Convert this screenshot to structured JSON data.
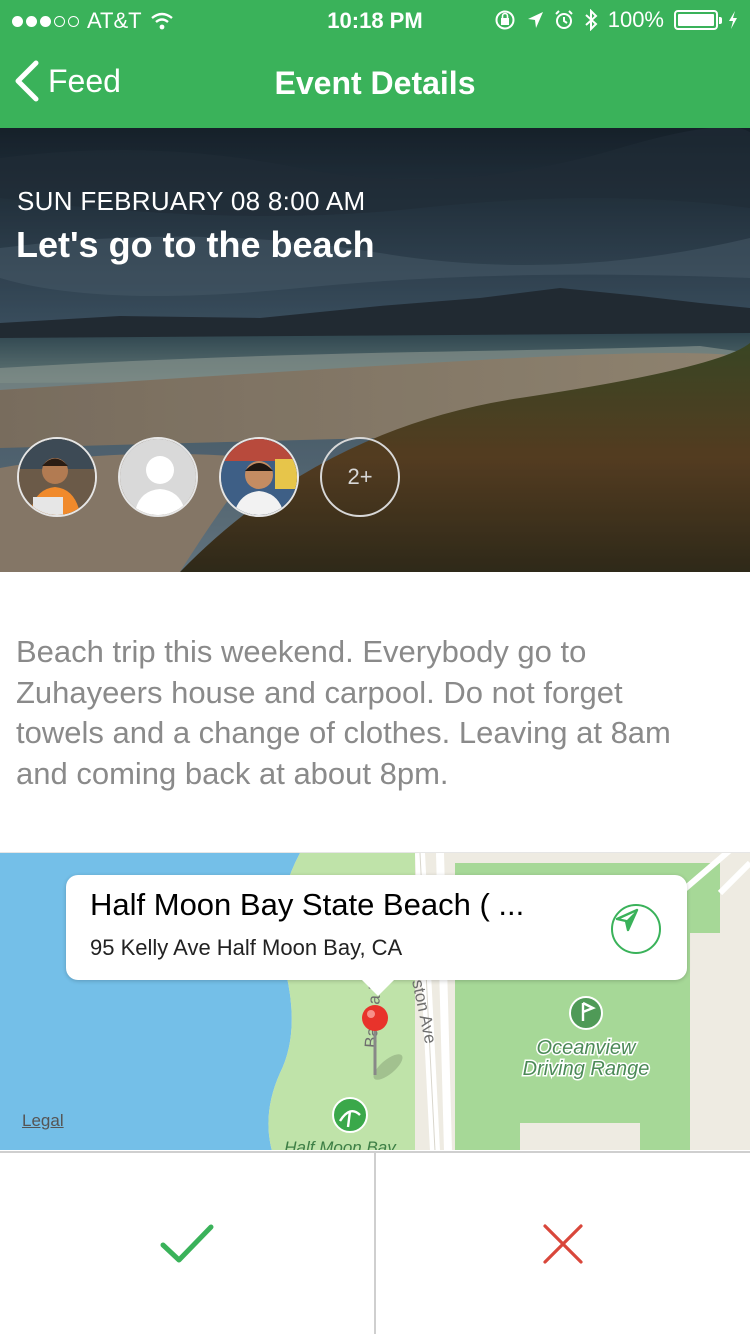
{
  "status_bar": {
    "carrier": "AT&T",
    "time": "10:18 PM",
    "battery": "100%"
  },
  "nav": {
    "back_label": "Feed",
    "title": "Event Details"
  },
  "event": {
    "datetime": "SUN FEBRUARY 08 8:00 AM",
    "title": "Let's go to the beach",
    "more_attendees": "2+",
    "description": "Beach trip this weekend. Everybody go to Zuhayeers house and carpool. Do not forget towels and a change of clothes. Leaving at 8am and coming back at about 8pm."
  },
  "map": {
    "place_name": "Half Moon Bay State Beach ( ...",
    "address": "95 Kelly Ave Half Moon Bay, CA",
    "legal": "Legal",
    "labels": {
      "street1": "ston Ave",
      "street2": "Balboa B",
      "poi": "Oceanview",
      "poi2": "Driving Range",
      "park": "Half Moon Bay"
    }
  },
  "colors": {
    "accent": "#3ab25a",
    "decline": "#d9473b",
    "description_text": "#8a8a8a"
  },
  "icons": {
    "back": "chevron-left-icon",
    "directions": "location-arrow-icon",
    "accept": "checkmark-icon",
    "decline": "x-icon"
  }
}
